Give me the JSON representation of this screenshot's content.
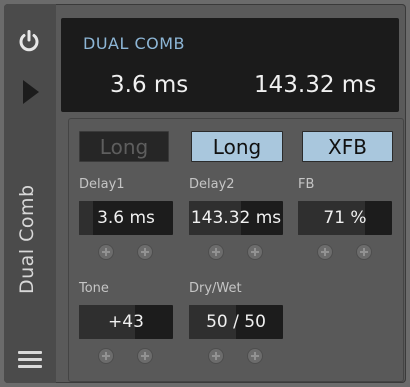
{
  "device": {
    "title": "Dual Comb",
    "header_name": "DUAL COMB",
    "header_delay1": "3.6 ms",
    "header_delay2": "143.32 ms"
  },
  "buttons": {
    "long1": "Long",
    "long2": "Long",
    "xfb": "XFB"
  },
  "params": {
    "delay1": {
      "label": "Delay1",
      "value": "3.6 ms",
      "level": 0.15
    },
    "delay2": {
      "label": "Delay2",
      "value": "143.32 ms",
      "level": 0.55
    },
    "fb": {
      "label": "FB",
      "value": "71 %",
      "level": 0.71
    },
    "tone": {
      "label": "Tone",
      "value": "+43",
      "level": 0.6
    },
    "drywet": {
      "label": "Dry/Wet",
      "value": "50 / 50",
      "level": 0.5
    }
  },
  "colors": {
    "accent_header_text": "#8db6d6",
    "active_button": "#a9c7dd"
  },
  "icons": [
    "power-icon",
    "play-icon",
    "menu-icon",
    "add-icon"
  ]
}
